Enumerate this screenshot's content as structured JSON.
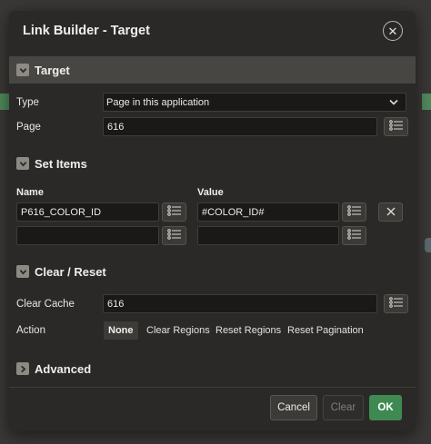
{
  "dialog": {
    "title": "Link Builder - Target",
    "close_glyph": "✕"
  },
  "sections": {
    "target": {
      "title": "Target",
      "expanded": true
    },
    "set_items": {
      "title": "Set Items",
      "expanded": true
    },
    "clear_reset": {
      "title": "Clear / Reset",
      "expanded": true
    },
    "advanced": {
      "title": "Advanced",
      "expanded": false
    }
  },
  "target": {
    "type_label": "Type",
    "type_value": "Page in this application",
    "page_label": "Page",
    "page_value": "616"
  },
  "set_items": {
    "name_header": "Name",
    "value_header": "Value",
    "rows": [
      {
        "name": "P616_COLOR_ID",
        "value": "#COLOR_ID#"
      },
      {
        "name": "",
        "value": ""
      }
    ]
  },
  "clear_reset": {
    "clear_cache_label": "Clear Cache",
    "clear_cache_value": "616",
    "action_label": "Action",
    "actions": [
      "None",
      "Clear Regions",
      "Reset Regions",
      "Reset Pagination"
    ],
    "selected_action": "None"
  },
  "footer": {
    "cancel_label": "Cancel",
    "clear_label": "Clear",
    "ok_label": "OK"
  },
  "icons": {
    "toggle_expanded": "chevron-down-icon",
    "toggle_collapsed": "chevron-right-icon",
    "list": "list-icon",
    "remove": "close-icon"
  },
  "colors": {
    "accent_ok": "#3f8a52",
    "dialog_bg": "#2b2927",
    "input_bg": "#1a1918"
  }
}
